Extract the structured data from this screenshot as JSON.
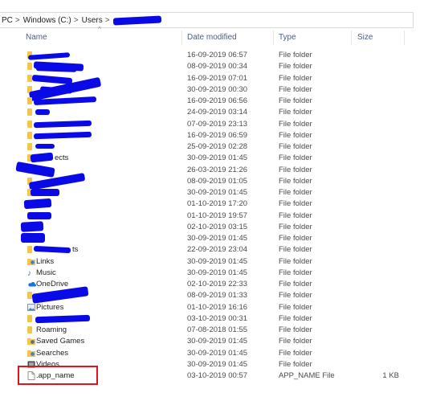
{
  "breadcrumb": {
    "items": [
      "PC",
      "Windows (C:)",
      "Users"
    ],
    "separator": ">"
  },
  "columns": {
    "name": "Name",
    "date": "Date modified",
    "type": "Type",
    "size": "Size"
  },
  "rows": [
    {
      "name": "",
      "date": "16-09-2019 06:57",
      "type": "File folder",
      "size": ""
    },
    {
      "name": "",
      "date": "08-09-2019 00:34",
      "type": "File folder",
      "size": ""
    },
    {
      "name": "",
      "date": "16-09-2019 07:01",
      "type": "File folder",
      "size": ""
    },
    {
      "name": "",
      "date": "30-09-2019 00:30",
      "type": "File folder",
      "size": ""
    },
    {
      "name": "",
      "date": "16-09-2019 06:56",
      "type": "File folder",
      "size": ""
    },
    {
      "name": "",
      "date": "24-09-2019 03:14",
      "type": "File folder",
      "size": ""
    },
    {
      "name": "",
      "date": "07-09-2019 23:13",
      "type": "File folder",
      "size": ""
    },
    {
      "name": "",
      "date": "16-09-2019 06:59",
      "type": "File folder",
      "size": ""
    },
    {
      "name": "",
      "date": "25-09-2019 02:28",
      "type": "File folder",
      "size": ""
    },
    {
      "name": "ects",
      "date": "30-09-2019 01:45",
      "type": "File folder",
      "size": ""
    },
    {
      "name": "",
      "date": "26-03-2019 21:26",
      "type": "File folder",
      "size": ""
    },
    {
      "name": "",
      "date": "08-09-2019 01:05",
      "type": "File folder",
      "size": ""
    },
    {
      "name": "",
      "date": "30-09-2019 01:45",
      "type": "File folder",
      "size": ""
    },
    {
      "name": "",
      "date": "01-10-2019 17:20",
      "type": "File folder",
      "size": ""
    },
    {
      "name": "",
      "date": "01-10-2019 19:57",
      "type": "File folder",
      "size": ""
    },
    {
      "name": "",
      "date": "02-10-2019 03:15",
      "type": "File folder",
      "size": ""
    },
    {
      "name": "",
      "date": "30-09-2019 01:45",
      "type": "File folder",
      "size": ""
    },
    {
      "name": "ts",
      "date": "22-09-2019 23:04",
      "type": "File folder",
      "size": ""
    },
    {
      "name": "Links",
      "date": "30-09-2019 01:45",
      "type": "File folder",
      "size": ""
    },
    {
      "name": "Music",
      "date": "30-09-2019 01:45",
      "type": "File folder",
      "size": ""
    },
    {
      "name": "OneDrive",
      "date": "02-10-2019 22:33",
      "type": "File folder",
      "size": ""
    },
    {
      "name": "",
      "date": "08-09-2019 01:33",
      "type": "File folder",
      "size": ""
    },
    {
      "name": "Pictures",
      "date": "01-10-2019 16:16",
      "type": "File folder",
      "size": ""
    },
    {
      "name": "",
      "date": "03-10-2019 00:31",
      "type": "File folder",
      "size": ""
    },
    {
      "name": "Roaming",
      "date": "07-08-2018 01:55",
      "type": "File folder",
      "size": ""
    },
    {
      "name": "Saved Games",
      "date": "30-09-2019 01:45",
      "type": "File folder",
      "size": ""
    },
    {
      "name": "Searches",
      "date": "30-09-2019 01:45",
      "type": "File folder",
      "size": ""
    },
    {
      "name": "Videos",
      "date": "30-09-2019 01:45",
      "type": "File folder",
      "size": ""
    },
    {
      "name": ".app_name",
      "date": "03-10-2019 00:57",
      "type": "APP_NAME File",
      "size": "1 KB"
    }
  ],
  "icons": {
    "folder_color": "#f3c54b",
    "highlight_color": "#e3131b",
    "redaction_color": "#0a0ae6"
  }
}
